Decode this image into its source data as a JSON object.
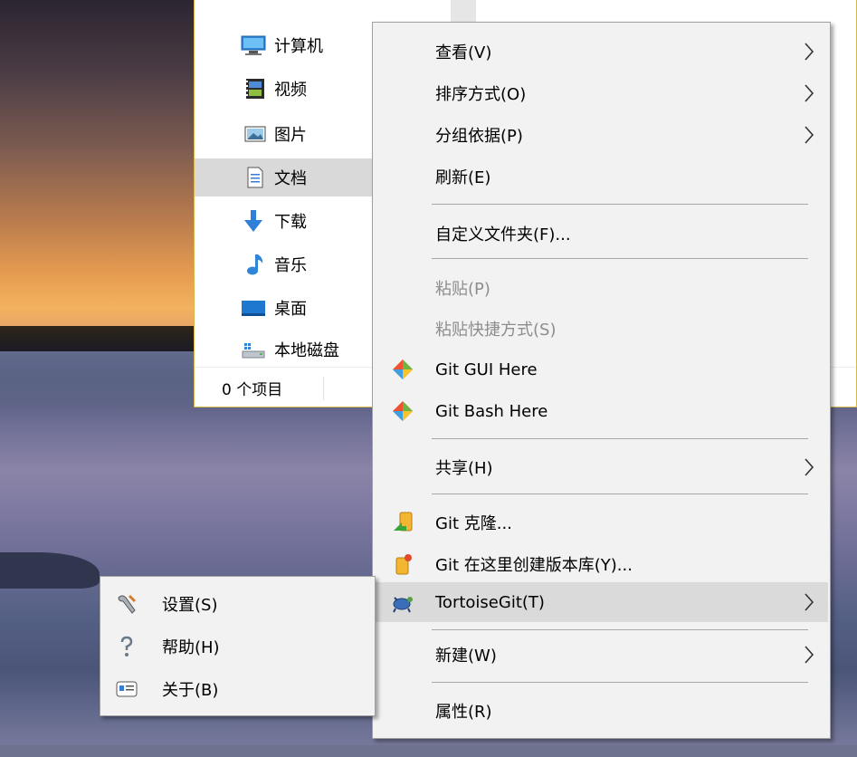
{
  "explorer": {
    "nav_items": [
      {
        "label": "计算机",
        "icon": "computer-icon"
      },
      {
        "label": "视频",
        "icon": "video-icon"
      },
      {
        "label": "图片",
        "icon": "pictures-icon"
      },
      {
        "label": "文档",
        "icon": "documents-icon",
        "selected": true
      },
      {
        "label": "下载",
        "icon": "download-icon"
      },
      {
        "label": "音乐",
        "icon": "music-icon"
      },
      {
        "label": "桌面",
        "icon": "desktop-icon"
      },
      {
        "label": "本地磁盘",
        "icon": "local-disk-icon"
      }
    ],
    "status": "0 个项目"
  },
  "context_menu": {
    "items": [
      {
        "label": "查看(V)",
        "submenu": true
      },
      {
        "label": "排序方式(O)",
        "submenu": true
      },
      {
        "label": "分组依据(P)",
        "submenu": true
      },
      {
        "label": "刷新(E)"
      },
      {
        "label": "自定义文件夹(F)..."
      },
      {
        "label": "粘贴(P)",
        "disabled": true
      },
      {
        "label": "粘贴快捷方式(S)",
        "disabled": true
      },
      {
        "label": "Git GUI Here",
        "icon": "git-icon"
      },
      {
        "label": "Git Bash Here",
        "icon": "git-icon"
      },
      {
        "label": "共享(H)",
        "submenu": true
      },
      {
        "label": "Git 克隆...",
        "icon": "git-clone-icon"
      },
      {
        "label": "Git 在这里创建版本库(Y)...",
        "icon": "git-create-repo-icon"
      },
      {
        "label": "TortoiseGit(T)",
        "icon": "tortoisegit-icon",
        "submenu": true,
        "highlighted": true
      },
      {
        "label": "新建(W)",
        "submenu": true
      },
      {
        "label": "属性(R)"
      }
    ]
  },
  "tortoisegit_submenu": {
    "items": [
      {
        "label": "设置(S)",
        "icon": "settings-wrench-icon"
      },
      {
        "label": "帮助(H)",
        "icon": "help-icon"
      },
      {
        "label": "关于(B)",
        "icon": "about-icon"
      }
    ]
  },
  "colors": {
    "menu_bg": "#f2f2f2",
    "menu_highlight": "#dadada",
    "disabled_text": "#8d8d8d",
    "explorer_border": "#d9b44a"
  }
}
